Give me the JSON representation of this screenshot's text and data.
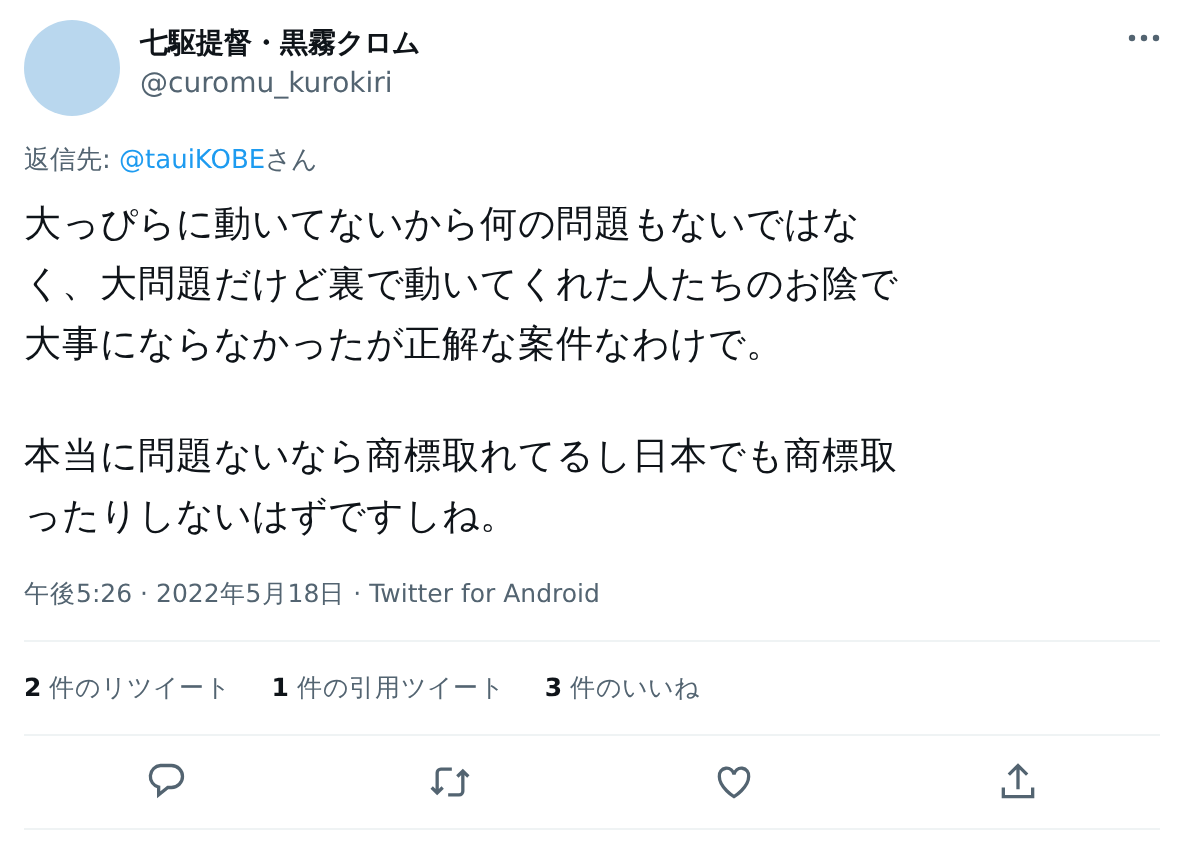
{
  "tweet": {
    "author": {
      "name": "七駆提督・黒霧クロム",
      "handle": "@curomu_kurokiri"
    },
    "reply_to": {
      "prefix": "返信先: ",
      "mention": "@tauiKOBE",
      "suffix": "さん"
    },
    "paragraphs": [
      "大っぴらに動いてないから何の問題もないではなく、大問題だけど裏で動いてくれた人たちのお陰で大事にならなかったが正解な案件なわけで。",
      "本当に問題ないなら商標取れてるし日本でも商標取ったりしないはずですしね。"
    ],
    "meta": "午後5:26 · 2022年5月18日 · Twitter for Android",
    "stats": [
      "**2** 件のリツイート",
      "**1** 件の引用ツイート",
      "**3** 件のいいね"
    ],
    "actions": [
      {
        "kind": "reply"
      },
      {
        "kind": "retweet"
      },
      {
        "kind": "like"
      },
      {
        "kind": "share"
      }
    ]
  }
}
